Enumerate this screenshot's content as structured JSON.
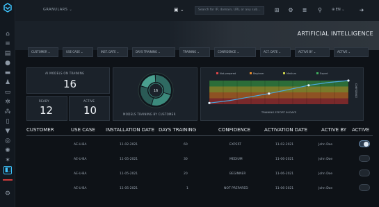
{
  "topbar": {
    "workspace": "GRANULARS",
    "search_placeholder": "Search for IP, domain, URL or any sub...",
    "icons": [
      "square-icon",
      "grid-icon",
      "gear-icon",
      "menu-icon",
      "search-icon",
      "globe-icon",
      "logout-icon"
    ],
    "language": "EN"
  },
  "hero": {
    "title": "ARTIFICIAL INTELLIGENCE"
  },
  "filters": [
    "CUSTOMER",
    "USE CASE",
    "INST. DATE",
    "DAYS TRAINING",
    "TRAINING",
    "CONFIDENCE",
    "ACT. DATE",
    "ACTIVE BY",
    "ACTIVE"
  ],
  "kpis": {
    "ai_models_label": "AI MODELS ON TRAINING",
    "ai_models_value": "16",
    "ready_label": "READY",
    "ready_value": "12",
    "active_label": "ACTIVE",
    "active_value": "10"
  },
  "donut": {
    "label": "MODELS TRAINING BY CUSTOMER",
    "center": "16",
    "segments": [
      30,
      25,
      25,
      20
    ],
    "colors": [
      "#2f6a62",
      "#3c8a7c",
      "#2a5a55",
      "#4aa08f"
    ]
  },
  "chart_data": {
    "type": "line",
    "xlabel": "TRAINING EFFORT IN DAYS",
    "ylabel": "CONFIDENCE",
    "legend": [
      "Not prepared",
      "Beginner",
      "Medium",
      "Expert"
    ],
    "legend_colors": [
      "#e0464a",
      "#e58a2f",
      "#c9d04a",
      "#3fae5e"
    ],
    "bands": [
      {
        "name": "Expert",
        "color": "#2f7a3b"
      },
      {
        "name": "Medium",
        "color": "#8a8a2a"
      },
      {
        "name": "Beginner",
        "color": "#a25a22"
      },
      {
        "name": "Not prepared",
        "color": "#8a2a2c"
      }
    ],
    "series": [
      {
        "values": [
          0.05,
          0.15,
          0.3,
          0.45,
          0.62,
          0.8,
          0.92,
          1.0
        ]
      }
    ],
    "markers": [
      0,
      3,
      5,
      7
    ],
    "line_color": "#4aa8e0"
  },
  "table": {
    "headers": [
      "CUSTOMER",
      "USE CASE",
      "INSTALLATION DATE",
      "DAYS TRAINING",
      "CONFIDENCE",
      "ACTIVATION DATE",
      "ACTIVE BY",
      "ACTIVE"
    ],
    "rows": [
      {
        "customer": "",
        "use_case": "AE-U-BA",
        "install": "11-02-2021",
        "days": "60",
        "confidence": "EXPERT",
        "activation": "11-02-2021",
        "active_by": "John Doe",
        "active": true
      },
      {
        "customer": "",
        "use_case": "AE-U-BA",
        "install": "11-05-2021",
        "days": "30",
        "confidence": "MEDIUM",
        "activation": "11-06-2021",
        "active_by": "John Doe",
        "active": false
      },
      {
        "customer": "",
        "use_case": "AE-U-BA",
        "install": "11-05-2021",
        "days": "20",
        "confidence": "BEGINNER",
        "activation": "11-06-2021",
        "active_by": "John Doe",
        "active": false
      },
      {
        "customer": "",
        "use_case": "AE-U-BA",
        "install": "11-05-2021",
        "days": "1",
        "confidence": "NOT PREPARED",
        "activation": "11-06-2021",
        "active_by": "John Doe",
        "active": false
      }
    ]
  }
}
